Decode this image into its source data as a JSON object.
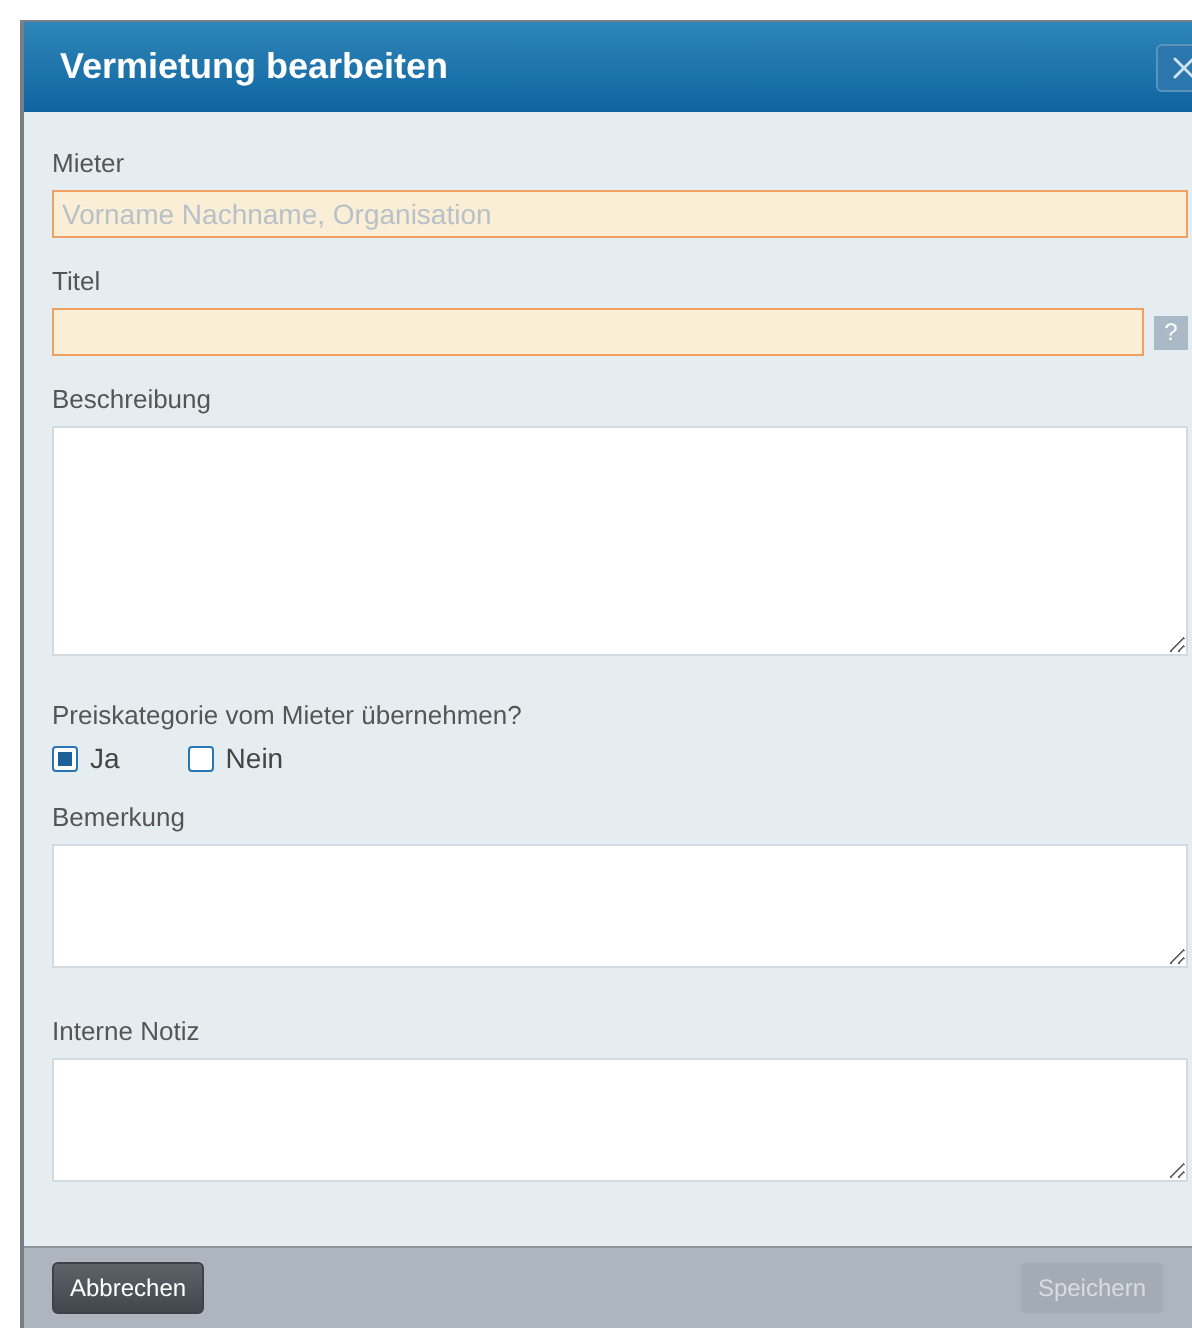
{
  "dialog": {
    "title": "Vermietung bearbeiten"
  },
  "fields": [
    {
      "kind": "input",
      "label": "Mieter",
      "placeholder": "Vorname Nachname, Organisation",
      "required": true
    },
    {
      "kind": "input",
      "label": "Titel",
      "required": true,
      "help": "?"
    },
    {
      "kind": "large-textarea",
      "label": "Beschreibung"
    },
    {
      "kind": "choice",
      "label": "Preiskategorie vom Mieter übernehmen?",
      "options": [
        {
          "label": "Ja",
          "selected": true
        },
        {
          "label": "Nein",
          "selected": false
        }
      ]
    },
    {
      "kind": "textarea",
      "label": "Bemerkung"
    },
    {
      "kind": "textarea",
      "label": "Interne Notiz"
    }
  ],
  "buttons": [
    {
      "label": "Abbrechen",
      "disabled": false
    },
    {
      "label": "Speichern",
      "disabled": true
    }
  ]
}
